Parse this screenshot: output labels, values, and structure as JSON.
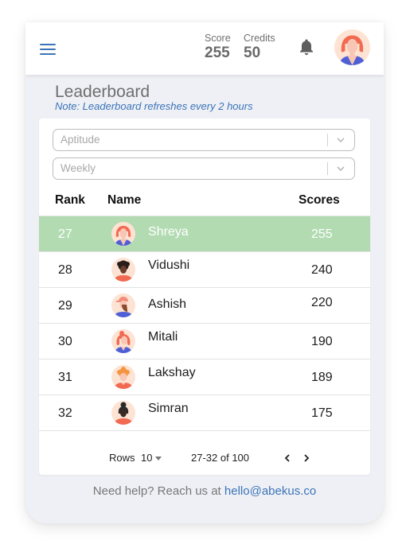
{
  "header": {
    "menu_icon": "hamburger-menu-icon",
    "score_label": "Score",
    "score_value": "255",
    "credits_label": "Credits",
    "credits_value": "50",
    "notification_icon": "bell-icon",
    "user_avatar": "female-avatar-red-hair"
  },
  "page": {
    "title": "Leaderboard",
    "note": "Note: Leaderboard refreshes every 2 hours"
  },
  "filters": {
    "category": {
      "value": "Aptitude"
    },
    "period": {
      "value": "Weekly"
    }
  },
  "table": {
    "columns": [
      "Rank",
      "Name",
      "Scores"
    ],
    "rows": [
      {
        "rank": "27",
        "name": "Shreya",
        "score": "255",
        "avatar": "female-red-hair",
        "highlighted": true
      },
      {
        "rank": "28",
        "name": "Vidushi",
        "score": "240",
        "avatar": "female-dark-curly-hair",
        "highlighted": false
      },
      {
        "rank": "29",
        "name": "Ashish",
        "score": "220",
        "avatar": "male-cap-beard",
        "highlighted": false
      },
      {
        "rank": "30",
        "name": "Mitali",
        "score": "190",
        "avatar": "female-red-bun",
        "highlighted": false
      },
      {
        "rank": "31",
        "name": "Lakshay",
        "score": "189",
        "avatar": "male-orange-curly-hair",
        "highlighted": false
      },
      {
        "rank": "32",
        "name": "Simran",
        "score": "175",
        "avatar": "female-dark-bun",
        "highlighted": false
      }
    ],
    "highlight_color": "#b2dbb2"
  },
  "pagination": {
    "rows_label": "Rows",
    "rows_value": "10",
    "range": "27-32 of 100"
  },
  "footer": {
    "help_text": "Need help? Reach us at",
    "email": "hello@abekus.co"
  },
  "colors": {
    "accent": "#3b74b8",
    "background": "#eff0f5",
    "highlight": "#b2dbb2"
  }
}
